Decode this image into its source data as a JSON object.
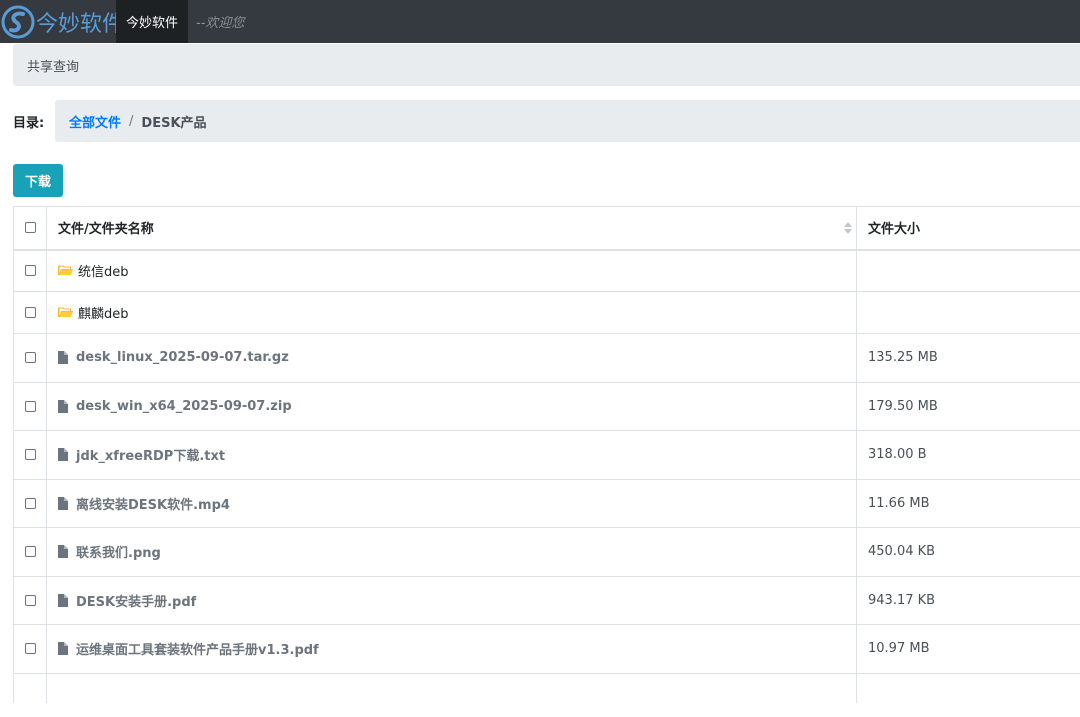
{
  "header": {
    "logo_text": "今妙软件",
    "app_tab": "今妙软件",
    "welcome": "--欢迎您",
    "accent_color": "#5a9bd5"
  },
  "subnav": {
    "label": "共享查询"
  },
  "breadcrumb": {
    "label": "目录:",
    "root": "全部文件",
    "separator": "/",
    "current": "DESK产品"
  },
  "actions": {
    "download_label": "下载",
    "button_color": "#17a2b8"
  },
  "table": {
    "columns": {
      "name": "文件/文件夹名称",
      "size": "文件大小"
    },
    "rows": [
      {
        "type": "folder",
        "name": "统信deb",
        "size": ""
      },
      {
        "type": "folder",
        "name": "麒麟deb",
        "size": ""
      },
      {
        "type": "file",
        "name": "desk_linux_2025-09-07.tar.gz",
        "size": "135.25 MB"
      },
      {
        "type": "file",
        "name": "desk_win_x64_2025-09-07.zip",
        "size": "179.50 MB"
      },
      {
        "type": "file",
        "name": "jdk_xfreeRDP下载.txt",
        "size": "318.00 B"
      },
      {
        "type": "file",
        "name": "离线安装DESK软件.mp4",
        "size": "11.66 MB"
      },
      {
        "type": "file",
        "name": "联系我们.png",
        "size": "450.04 KB"
      },
      {
        "type": "file",
        "name": "DESK安装手册.pdf",
        "size": "943.17 KB"
      },
      {
        "type": "file",
        "name": "运维桌面工具套装软件产品手册v1.3.pdf",
        "size": "10.97 MB"
      }
    ]
  }
}
